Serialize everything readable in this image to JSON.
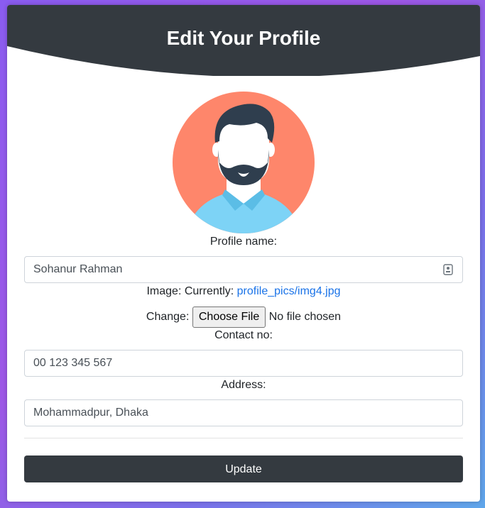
{
  "header": {
    "title": "Edit Your Profile"
  },
  "form": {
    "profile_name_label": "Profile name:",
    "profile_name_value": "Sohanur Rahman",
    "image_label": "Image: Currently:",
    "image_current_link": "profile_pics/img4.jpg",
    "change_label": "Change:",
    "choose_file_label": "Choose File",
    "no_file_text": "No file chosen",
    "contact_label": "Contact no:",
    "contact_value": "00 123 345 567",
    "address_label": "Address:",
    "address_value": "Mohammadpur, Dhaka",
    "update_label": "Update"
  },
  "icons": {
    "name_field_icon": "contact-card-icon",
    "avatar": "user-avatar-icon"
  },
  "colors": {
    "header_bg": "#343a40",
    "avatar_bg": "#fe866b",
    "link": "#1a73e8",
    "button_bg": "#343a40"
  }
}
